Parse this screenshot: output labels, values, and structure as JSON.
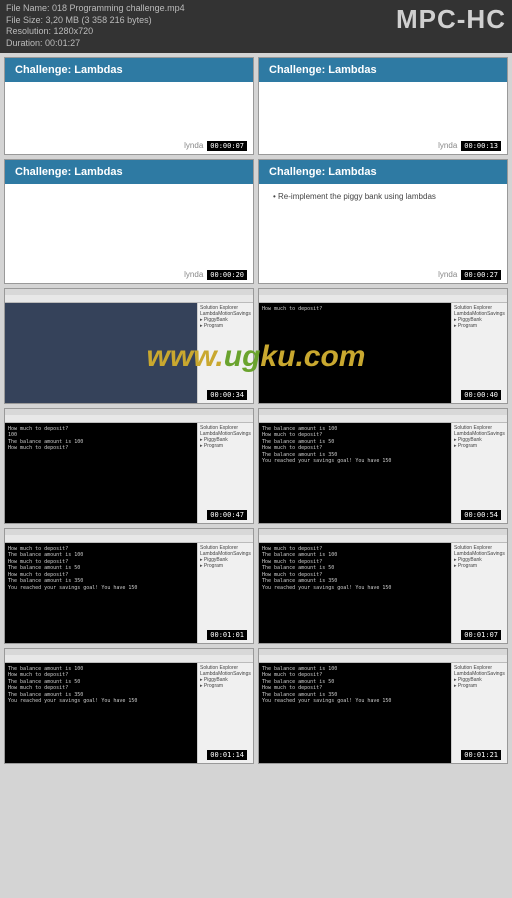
{
  "header": {
    "file_name_label": "File Name:",
    "file_name": "018 Programming challenge.mp4",
    "file_size_label": "File Size:",
    "file_size": "3,20 MB (3 358 216 bytes)",
    "resolution_label": "Resolution:",
    "resolution": "1280x720",
    "duration_label": "Duration:",
    "duration": "00:01:27",
    "app": "MPC-HC"
  },
  "slides": {
    "title": "Challenge: Lambdas",
    "brand": "lynda",
    "bullet": "• Re-implement the piggy bank using lambdas"
  },
  "timestamps": [
    "00:00:07",
    "00:00:13",
    "00:00:20",
    "00:00:27",
    "00:00:34",
    "00:00:40",
    "00:00:47",
    "00:00:54",
    "00:01:01",
    "00:01:07",
    "00:01:14",
    "00:01:21"
  ],
  "watermark": "www.ugku.com",
  "console": {
    "prompt": "How much to deposit?",
    "balance100": "The balance amount is 100",
    "balance50": "The balance amount is 50",
    "balance350": "The balance amount is 350",
    "goal": "You reached your savings goal! You have 150"
  },
  "side": {
    "l1": "Solution Explorer",
    "l2": "LambdaMotionSavings",
    "l3": "▸ PiggyBank",
    "l4": "▸ Program"
  }
}
